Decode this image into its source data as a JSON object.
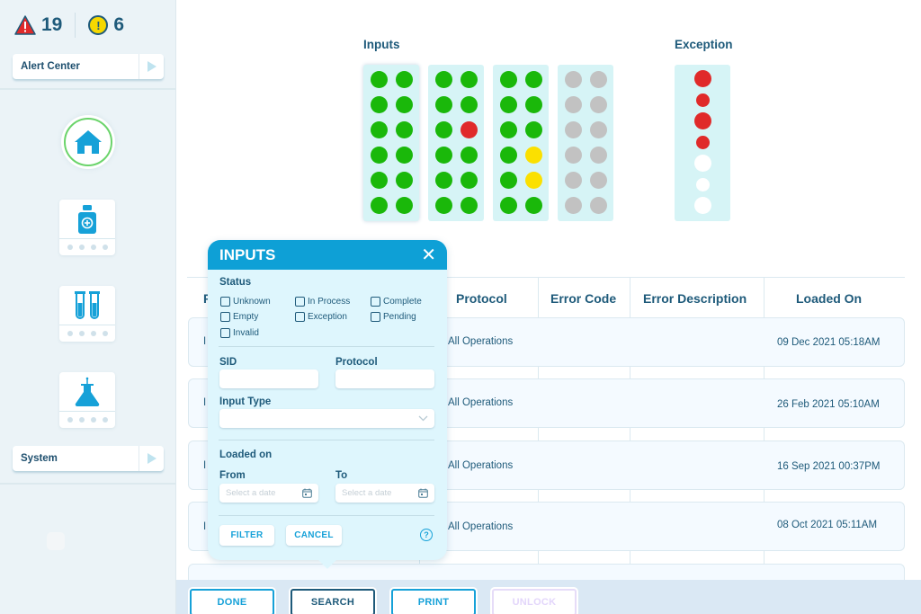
{
  "sidebar": {
    "alerts": {
      "error_count": "19",
      "warning_count": "6"
    },
    "alert_center_label": "Alert Center",
    "system_label": "System",
    "tiles": [
      "home",
      "reagent-bottle",
      "test-tubes",
      "flask"
    ]
  },
  "racks": {
    "inputs_title": "Inputs",
    "exception_title": "Exception",
    "colors": {
      "green": "#1ab80a",
      "red": "#e02a2a",
      "yellow": "#fbe000",
      "gray": "#c2c2c2",
      "white": "#ffffff"
    },
    "input_racks": [
      {
        "selected": true,
        "dots": [
          "green",
          "green",
          "green",
          "green",
          "green",
          "green",
          "green",
          "green",
          "green",
          "green",
          "green",
          "green"
        ]
      },
      {
        "selected": false,
        "dots": [
          "green",
          "green",
          "green",
          "green",
          "green",
          "red",
          "green",
          "green",
          "green",
          "green",
          "green",
          "green"
        ]
      },
      {
        "selected": false,
        "dots": [
          "green",
          "green",
          "green",
          "green",
          "green",
          "green",
          "green",
          "yellow",
          "green",
          "yellow",
          "green",
          "green"
        ]
      },
      {
        "selected": false,
        "dots": [
          "gray",
          "gray",
          "gray",
          "gray",
          "gray",
          "gray",
          "gray",
          "gray",
          "gray",
          "gray",
          "gray",
          "gray"
        ]
      }
    ],
    "exception_rack": [
      {
        "color": "red",
        "size": "large"
      },
      {
        "color": "red",
        "size": "small"
      },
      {
        "color": "red",
        "size": "large"
      },
      {
        "color": "red",
        "size": "small"
      },
      {
        "color": "white",
        "size": "large"
      },
      {
        "color": "white",
        "size": "small"
      },
      {
        "color": "white",
        "size": "large"
      }
    ]
  },
  "table": {
    "headers": [
      "P",
      "Protocol",
      "Error Code",
      "Error Description",
      "Loaded On"
    ],
    "rows": [
      {
        "first": "I",
        "protocol": "All Operations",
        "error_code": "",
        "error_description": "",
        "loaded_on": "09 Dec 2021  05:18AM"
      },
      {
        "first": "I",
        "protocol": "All Operations",
        "error_code": "",
        "error_description": "",
        "loaded_on": "26 Feb 2021  05:10AM"
      },
      {
        "first": "I",
        "protocol": "All Operations",
        "error_code": "",
        "error_description": "",
        "loaded_on": "16 Sep 2021  00:37PM"
      },
      {
        "first": "I",
        "protocol": "All Operations",
        "error_code": "",
        "error_description": "",
        "loaded_on": "08 Oct 2021  05:11AM"
      }
    ]
  },
  "popup": {
    "title": "INPUTS",
    "status_label": "Status",
    "status_options": [
      "Unknown",
      "In Process",
      "Complete",
      "Empty",
      "Exception",
      "Pending",
      "Invalid"
    ],
    "sid_label": "SID",
    "sid_value": "",
    "protocol_label": "Protocol",
    "protocol_value": "",
    "input_type_label": "Input Type",
    "input_type_value": "",
    "loaded_on_label": "Loaded on",
    "from_label": "From",
    "to_label": "To",
    "date_placeholder": "Select a date",
    "filter_label": "FILTER",
    "cancel_label": "CANCEL",
    "help_glyph": "?"
  },
  "bottom_bar": {
    "done_label": "DONE",
    "search_label": "SEARCH",
    "print_label": "PRINT",
    "unlock_label": "UNLOCK"
  }
}
